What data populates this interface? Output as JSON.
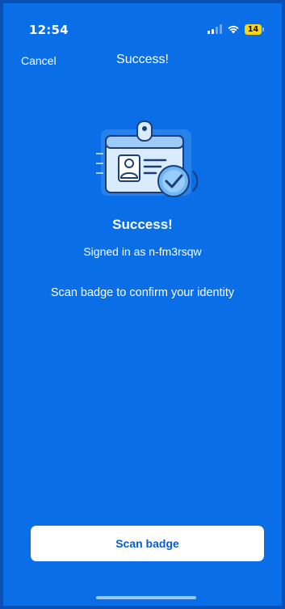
{
  "status_bar": {
    "time": "12:54",
    "battery_level": "14",
    "battery_color": "#ffd60a",
    "icons": [
      "signal-icon",
      "wifi-icon",
      "battery-icon"
    ]
  },
  "nav": {
    "cancel_label": "Cancel",
    "title": "Success!"
  },
  "main": {
    "illustration_icon": "id-badge-check-icon",
    "heading": "Success!",
    "signed_in_text": "Signed in as n-fm3rsqw",
    "instruction": "Scan badge to confirm your identity"
  },
  "footer": {
    "scan_button_label": "Scan badge"
  },
  "colors": {
    "background": "#0a6ee6",
    "button_text": "#0a5bd0",
    "button_background": "#ffffff"
  }
}
